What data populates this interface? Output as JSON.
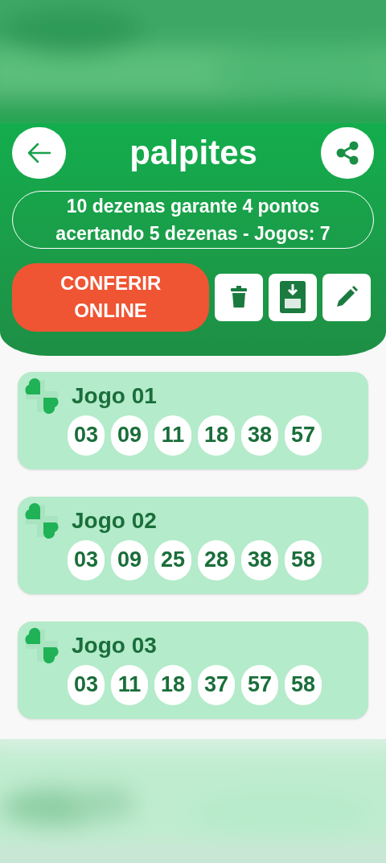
{
  "header": {
    "title": "palpites",
    "info_lines": [
      "10 dezenas garante 4 pontos",
      "acertando 5 dezenas - Jogos: 7"
    ]
  },
  "actions": {
    "check_button": "CONFERIR ONLINE"
  },
  "games": [
    {
      "title": "Jogo 01",
      "numbers": [
        "03",
        "09",
        "11",
        "18",
        "38",
        "57"
      ]
    },
    {
      "title": "Jogo 02",
      "numbers": [
        "03",
        "09",
        "25",
        "28",
        "38",
        "58"
      ]
    },
    {
      "title": "Jogo 03",
      "numbers": [
        "03",
        "11",
        "18",
        "37",
        "57",
        "58"
      ]
    }
  ]
}
